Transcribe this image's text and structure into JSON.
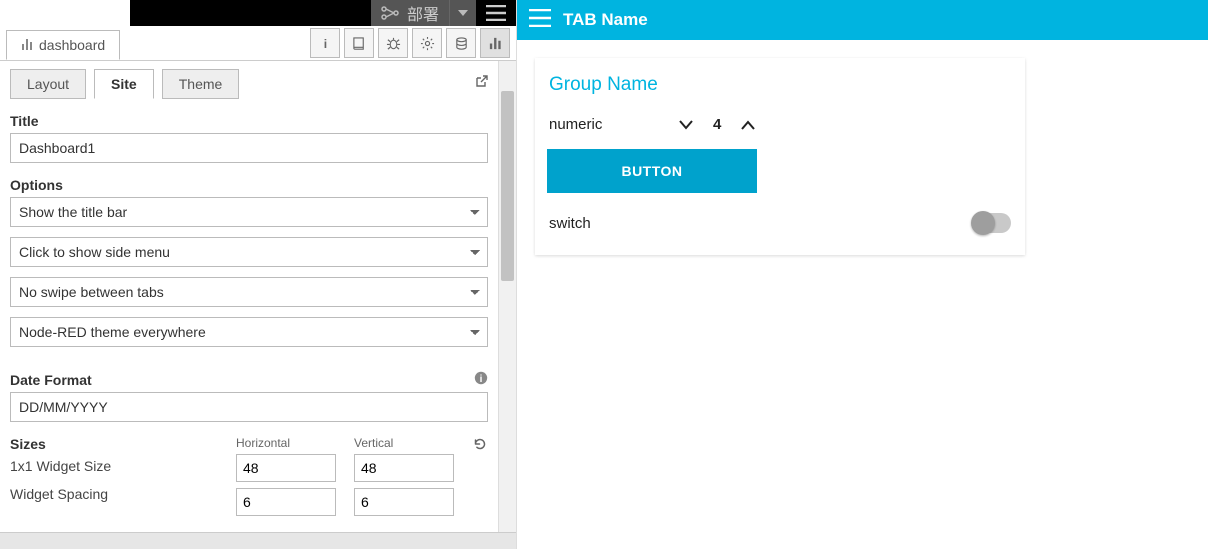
{
  "top": {
    "deploy_label": "部署"
  },
  "flow_tab": {
    "label": "dashboard"
  },
  "config_tabs": {
    "layout": "Layout",
    "site": "Site",
    "theme": "Theme"
  },
  "labels": {
    "title": "Title",
    "options": "Options",
    "date_format": "Date Format",
    "sizes": "Sizes",
    "horizontal": "Horizontal",
    "vertical": "Vertical",
    "widget_size": "1x1 Widget Size",
    "widget_spacing": "Widget Spacing"
  },
  "values": {
    "title": "Dashboard1",
    "opt_titlebar": "Show the title bar",
    "opt_sidemenu": "Click to show side menu",
    "opt_swipe": "No swipe between tabs",
    "opt_theme": "Node-RED theme everywhere",
    "date_format": "DD/MM/YYYY",
    "size_h": "48",
    "size_v": "48",
    "spacing_h": "6",
    "spacing_v": "6"
  },
  "dashboard": {
    "tab_name": "TAB Name",
    "group_name": "Group Name",
    "numeric_label": "numeric",
    "numeric_value": "4",
    "button_label": "BUTTON",
    "switch_label": "switch"
  }
}
